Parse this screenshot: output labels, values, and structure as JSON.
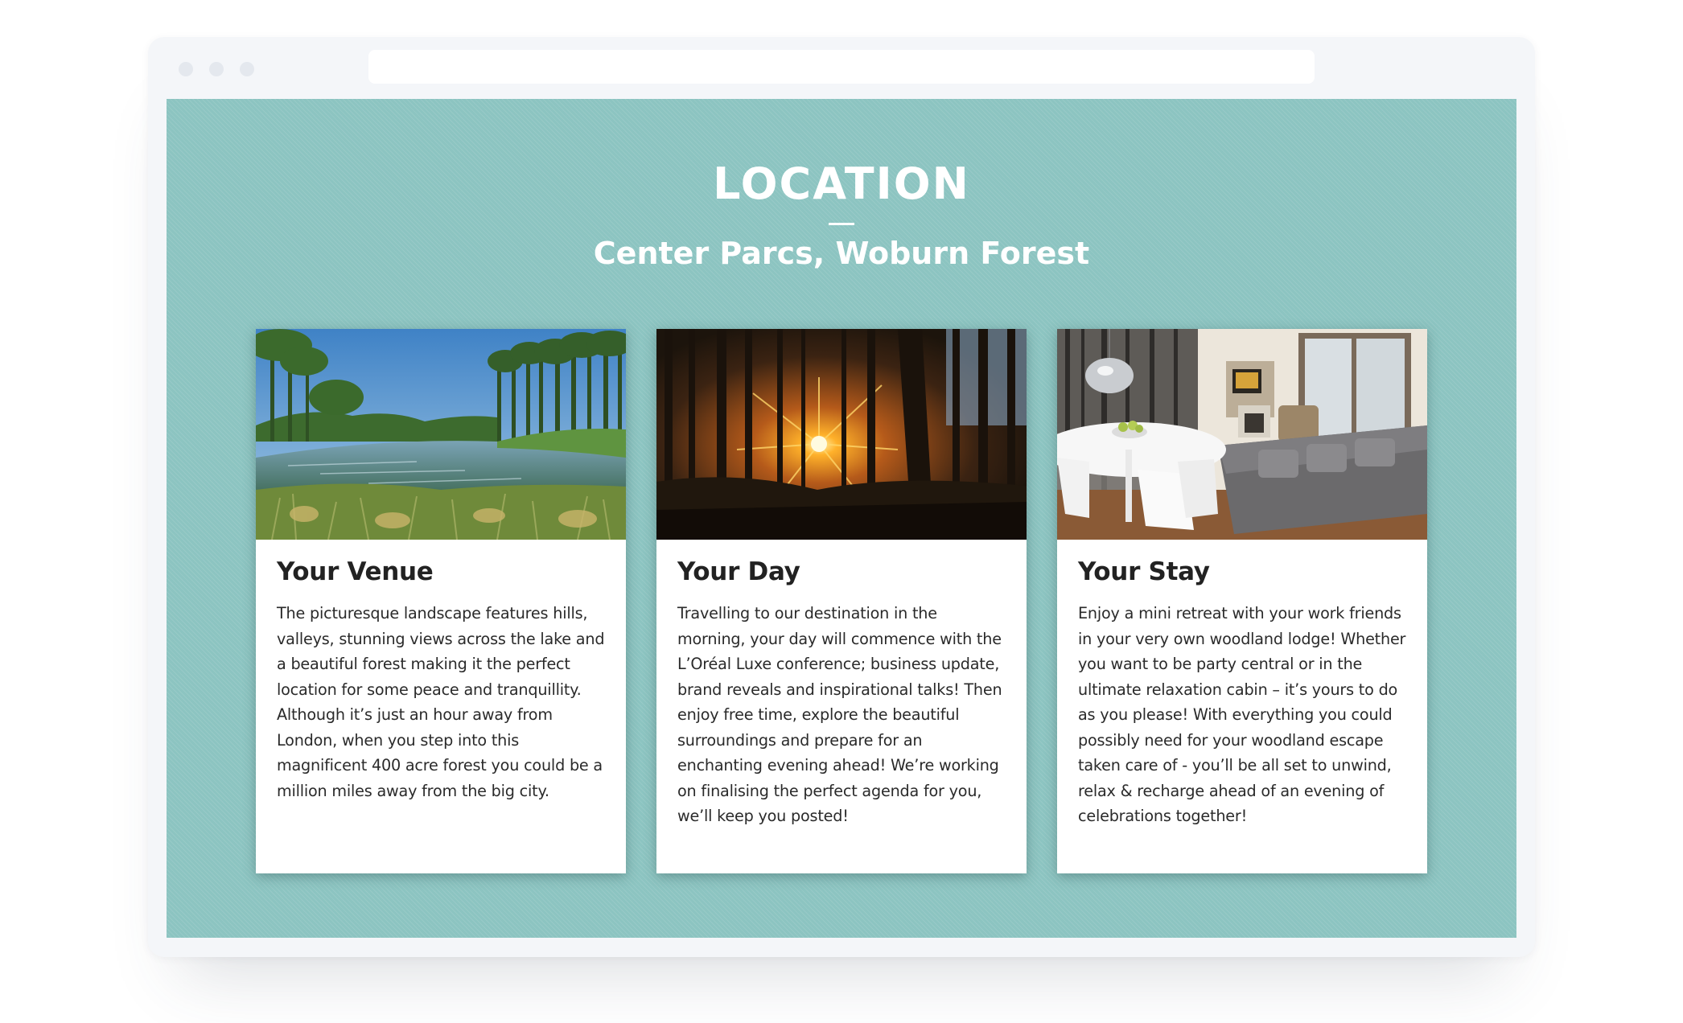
{
  "section": {
    "title": "LOCATION",
    "subtitle": "Center Parcs, Woburn Forest"
  },
  "cards": [
    {
      "title": "Your Venue",
      "text": "The picturesque landscape features hills, valleys, stunning views across the lake and a beautiful forest making it the perfect location for some peace and tranquillity. Although it’s just an hour away from London, when you step into this magnificent 400 acre forest you could be a million miles away from the big city.",
      "image": "lake-forest-photo"
    },
    {
      "title": "Your Day",
      "text": "Travelling to our destination in the morning, your day will commence with the L’Oréal Luxe conference; business update, brand reveals and inspirational talks! Then enjoy free time, explore the beautiful surroundings and prepare for an enchanting evening ahead! We’re working on finalising the perfect agenda for you, we’ll keep you posted!",
      "image": "sunset-forest-photo"
    },
    {
      "title": "Your Stay",
      "text": "Enjoy a mini retreat with your work friends in your very own woodland lodge! Whether you want to be party central or in the ultimate relaxation cabin – it’s yours to do as you please! With everything you could possibly need for your woodland escape taken care of - you’ll be all set to unwind, relax & recharge ahead of an evening of celebrations together!",
      "image": "lodge-interior-photo"
    }
  ],
  "colors": {
    "section_background": "#8cc4c1",
    "card_background": "#ffffff",
    "title_text": "#ffffff",
    "body_text": "#2a2a2a"
  }
}
